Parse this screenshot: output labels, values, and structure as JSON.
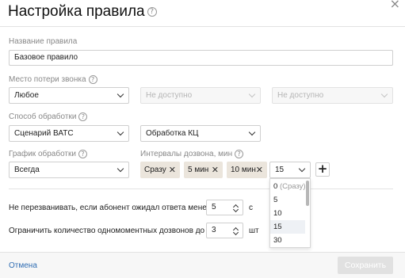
{
  "dialog": {
    "title": "Настройка правила",
    "help_glyph": "?",
    "close_glyph": "×"
  },
  "rule_name": {
    "label": "Название правила",
    "value": "Базовое правило"
  },
  "call_loss": {
    "label": "Место потери звонка",
    "select1": "Любое",
    "select2": "Не доступно",
    "select3": "Не доступно"
  },
  "processing": {
    "label": "Способ обработки",
    "select1": "Сценарий ВАТС",
    "select2": "Обработка КЦ"
  },
  "schedule": {
    "label": "График обработки",
    "value": "Всегда"
  },
  "intervals": {
    "label": "Интервалы дозвона, мин",
    "chips": [
      "Сразу",
      "5 мин",
      "10 мин"
    ],
    "remove_glyph": "✕",
    "select_value": "15",
    "add_glyph": "+",
    "dropdown_options": [
      {
        "value": "0",
        "note": "(Сразу)"
      },
      {
        "value": "5",
        "note": ""
      },
      {
        "value": "10",
        "note": ""
      },
      {
        "value": "15",
        "note": ""
      },
      {
        "value": "30",
        "note": ""
      }
    ],
    "highlighted_option": "15"
  },
  "no_callback": {
    "label": "Не перезванивать, если абонент ожидал ответа менее",
    "value": "5",
    "unit": "с"
  },
  "limit": {
    "label": "Ограничить количество одномоментных дозвонов до",
    "value": "3",
    "unit": "шт"
  },
  "footer": {
    "cancel_label": "Отмена",
    "save_label": "Сохранить"
  }
}
